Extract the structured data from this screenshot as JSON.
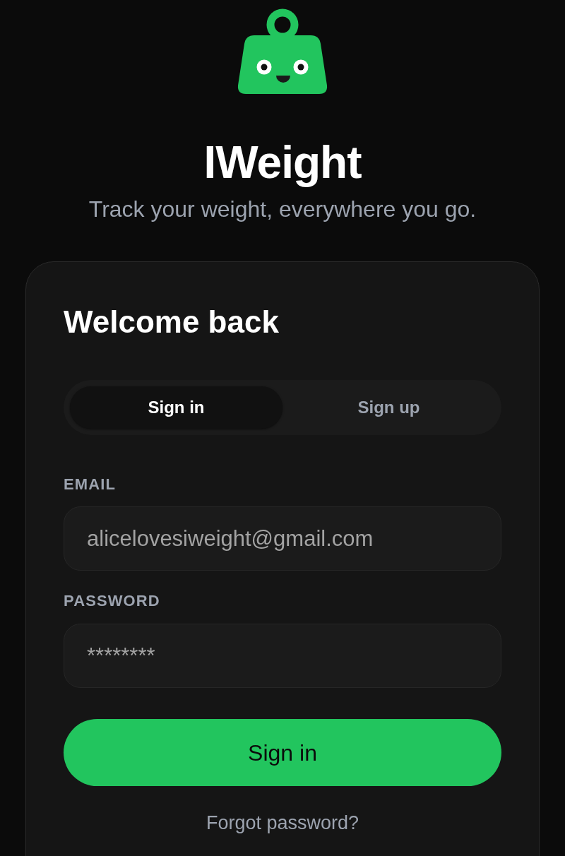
{
  "brand": {
    "title": "IWeight",
    "tagline": "Track your weight, everywhere you go."
  },
  "card": {
    "heading": "Welcome back",
    "tabs": [
      {
        "label": "Sign in",
        "selected": true
      },
      {
        "label": "Sign up",
        "selected": false
      }
    ],
    "fields": [
      {
        "label": "EMAIL",
        "value": "alicelovesiweight@gmail.com"
      },
      {
        "label": "PASSWORD",
        "value": "********"
      }
    ],
    "submit_button": "Sign in",
    "forgot_link": "Forgot password?"
  }
}
